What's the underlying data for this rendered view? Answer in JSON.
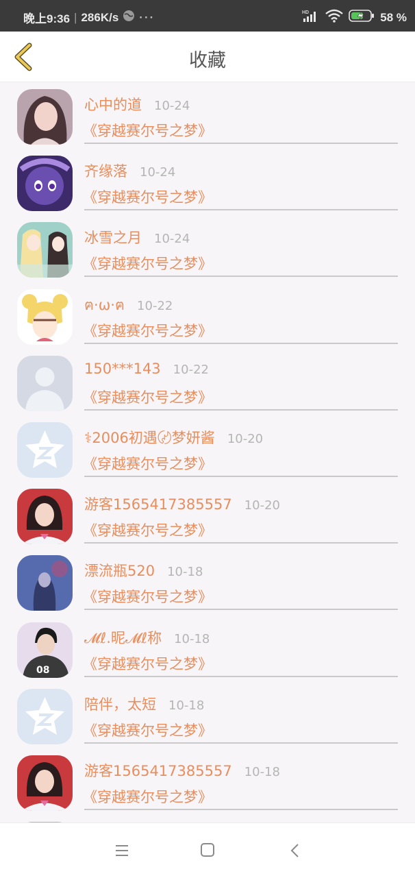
{
  "status_bar": {
    "time": "晚上9:36",
    "speed": "286K/s",
    "dots": "···",
    "network_label": "HD",
    "battery_percent": "58 %"
  },
  "header": {
    "title": "收藏"
  },
  "items": [
    {
      "name": "心中的道",
      "date": "10-24",
      "book": "《穿越赛尔号之梦》",
      "avatar": "photo-girl-icon",
      "color": "#8a6f78"
    },
    {
      "name": "齐缘落",
      "date": "10-24",
      "book": "《穿越赛尔号之梦》",
      "avatar": "anime-purple-icon",
      "color": "#6b4fb0"
    },
    {
      "name": "冰雪之月",
      "date": "10-24",
      "book": "《穿越赛尔号之梦》",
      "avatar": "anime-pair-icon",
      "color": "#9fd1c9"
    },
    {
      "name": "ฅ·ω·ฅ",
      "date": "10-22",
      "book": "《穿越赛尔号之梦》",
      "avatar": "sailor-moon-icon",
      "color": "#f3d56a"
    },
    {
      "name": "150***143",
      "date": "10-22",
      "book": "《穿越赛尔号之梦》",
      "avatar": "default-person-icon",
      "color": "#d4d9e4"
    },
    {
      "name": "⚕2006初遇〄梦妍酱",
      "date": "10-20",
      "book": "《穿越赛尔号之梦》",
      "avatar": "qzone-star-icon",
      "color": "#dbe6f2"
    },
    {
      "name": "游客1565417385557",
      "date": "10-20",
      "book": "《穿越赛尔号之梦》",
      "avatar": "photo-student-icon",
      "color": "#6b4a3a"
    },
    {
      "name": "漂流瓶520",
      "date": "10-18",
      "book": "《穿越赛尔号之梦》",
      "avatar": "photo-blue-icon",
      "color": "#5a6aa8"
    },
    {
      "name": "𝓜ℓ.昵𝓜ℓ称",
      "date": "10-18",
      "book": "《穿越赛尔号之梦》",
      "avatar": "photo-boy-icon",
      "color": "#3a3a3a"
    },
    {
      "name": "陪伴，太短",
      "date": "10-18",
      "book": "《穿越赛尔号之梦》",
      "avatar": "qzone-star-icon",
      "color": "#dbe6f2"
    },
    {
      "name": "游客1565417385557",
      "date": "10-18",
      "book": "《穿越赛尔号之梦》",
      "avatar": "photo-student-icon",
      "color": "#6b4a3a"
    }
  ],
  "colors": {
    "accent": "#e88e5e",
    "back_arrow": "#e8c95a"
  }
}
